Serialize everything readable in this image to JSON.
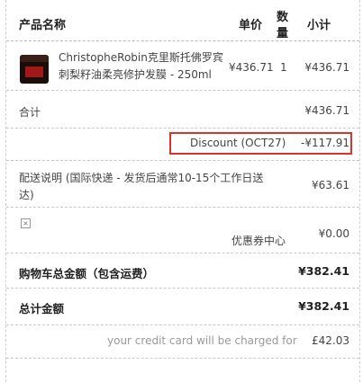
{
  "header": {
    "product": "产品名称",
    "price": "单价",
    "qty_line1": "数",
    "qty_line2": "量",
    "subtotal": "小计"
  },
  "item": {
    "name_line1": "ChristopheRobin克里斯托佛罗宾",
    "name_line2": "刺梨籽油柔亮修护发膜 - 250ml",
    "price": "¥436.71",
    "qty": "1",
    "subtotal": "¥436.71"
  },
  "total": {
    "label": "合计",
    "value": "¥436.71"
  },
  "discount": {
    "label": "Discount (OCT27)",
    "value": "-¥117.91"
  },
  "shipping": {
    "label_line1": "配送说明 (国际快递 - 发货后通常10-15个工作日送",
    "label_line2": "达)",
    "value": "¥63.61"
  },
  "coupon": {
    "label": "优惠券中心",
    "value": "¥0.00"
  },
  "cart_total": {
    "label": "购物车总金额（包含运费）",
    "value": "¥382.41"
  },
  "grand_total": {
    "label": "总计金额",
    "value": "¥382.41"
  },
  "charge": {
    "label": "your credit card will be charged for",
    "value": "£42.03"
  }
}
